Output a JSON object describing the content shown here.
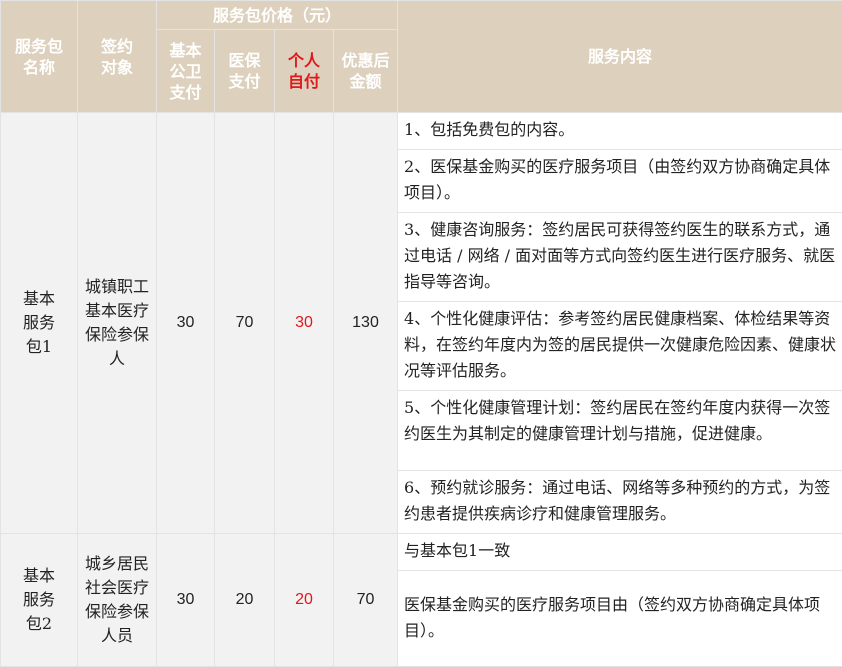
{
  "header": {
    "package_name": "服务包\n名称",
    "target": "签约\n对象",
    "price_group": "服务包价格（元）",
    "basic_public_health": "基本\n公卫\n支付",
    "medical_insurance": "医保\n支付",
    "self_pay": "个人\n自付",
    "discounted_total": "优惠后\n金额",
    "service_content": "服务内容"
  },
  "rows": [
    {
      "package": "基本\n服务\n包1",
      "target": "城镇职工\n基本医疗\n保险参保\n人",
      "basic_public_health": "30",
      "medical_insurance": "70",
      "self_pay": "30",
      "discounted_total": "130",
      "services": [
        "1、包括免费包的内容。",
        "2、医保基金购买的医疗服务项目（由签约双方协商确定具体项目）。",
        "3、健康咨询服务：签约居民可获得签约医生的联系方式，通过电话 / 网络 / 面对面等方式向签约医生进行医疗服务、就医指导等咨询。",
        "4、个性化健康评估：参考签约居民健康档案、体检结果等资料，在签约年度内为签的居民提供一次健康危险因素、健康状况等评估服务。",
        "5、个性化健康管理计划：签约居民在签约年度内获得一次签约医生为其制定的健康管理计划与措施，促进健康。",
        "6、预约就诊服务：通过电话、网络等多种预约的方式，为签约患者提供疾病诊疗和健康管理服务。"
      ]
    },
    {
      "package": "基本\n服务\n包2",
      "target": "城乡居民\n社会医疗\n保险参保\n人员",
      "basic_public_health": "30",
      "medical_insurance": "20",
      "self_pay": "20",
      "discounted_total": "70",
      "services": [
        "与基本包1一致",
        "医保基金购买的医疗服务项目由（签约双方协商确定具体项目）。"
      ]
    }
  ],
  "colors": {
    "header_bg": "#ddd1bd",
    "header_text": "#ffffff",
    "self_pay_accent": "#e0171c",
    "body_bg": "#f2f2f2"
  }
}
